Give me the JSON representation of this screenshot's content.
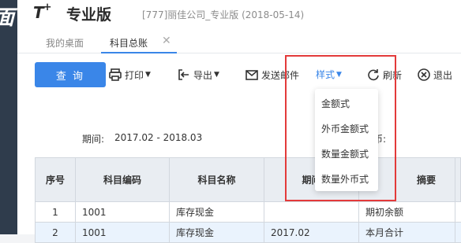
{
  "app": {
    "logo": "T",
    "logo_plus": "+",
    "product": "专业版",
    "company": "[777]丽佳公司_专业版 (2018-05-14)",
    "left_glyph": "面"
  },
  "tabs": [
    {
      "label": "我的桌面"
    },
    {
      "label": "科目总账"
    }
  ],
  "tab_close": "✕",
  "toolbar": {
    "query": "查 询",
    "print": "打印",
    "export": "导出",
    "email": "发送邮件",
    "style": "样式",
    "refresh": "刷新",
    "exit": "退出"
  },
  "style_menu": {
    "options": [
      "金额式",
      "外币金额式",
      "数量金额式",
      "数量外币式"
    ]
  },
  "report": {
    "period_label": "期间:",
    "period_value": "2017.02 - 2018.03",
    "currency_fragment": "币:"
  },
  "table": {
    "headers": [
      "序号",
      "科目编码",
      "科目名称",
      "期间",
      "摘要"
    ],
    "rows": [
      [
        "1",
        "1001",
        "库存现金",
        "",
        "期初余额"
      ],
      [
        "2",
        "1001",
        "库存现金",
        "2017.02",
        "本月合计"
      ]
    ]
  },
  "colors": {
    "accent": "#3a86e8",
    "highlight": "#e33a3a"
  }
}
